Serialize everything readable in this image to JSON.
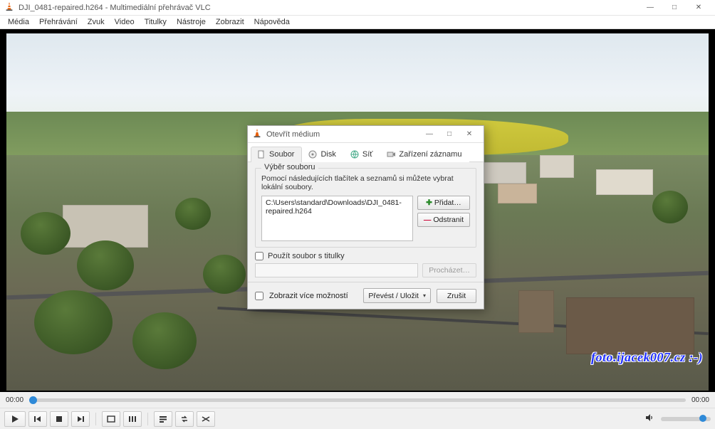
{
  "window": {
    "title": "DJI_0481-repaired.h264 - Multimediální přehrávač VLC",
    "min_label": "—",
    "max_label": "□",
    "close_label": "✕"
  },
  "menu": {
    "items": [
      "Média",
      "Přehrávání",
      "Zvuk",
      "Video",
      "Titulky",
      "Nástroje",
      "Zobrazit",
      "Nápověda"
    ]
  },
  "time": {
    "left": "00:00",
    "right": "00:00"
  },
  "modal": {
    "title": "Otevřít médium",
    "tabs": {
      "file": "Soubor",
      "disk": "Disk",
      "net": "Síť",
      "capture": "Zařízení záznamu"
    },
    "group_title": "Výběr souboru",
    "help_text": "Pomocí následujících tlačítek a seznamů si můžete vybrat lokální soubory.",
    "file_entry": "C:\\Users\\standard\\Downloads\\DJI_0481-repaired.h264",
    "add_button": "Přidat…",
    "remove_button": "Odstranit",
    "subtitle_checkbox": "Použít soubor s titulky",
    "browse_button": "Procházet…",
    "more_options": "Zobrazit více možností",
    "convert_button": "Převést / Uložit",
    "cancel_button": "Zrušit"
  },
  "watermark": "foto.ijacek007.cz :-)",
  "icons": {
    "add_plus": "✚",
    "remove_minus": "—",
    "caret": "▾"
  }
}
